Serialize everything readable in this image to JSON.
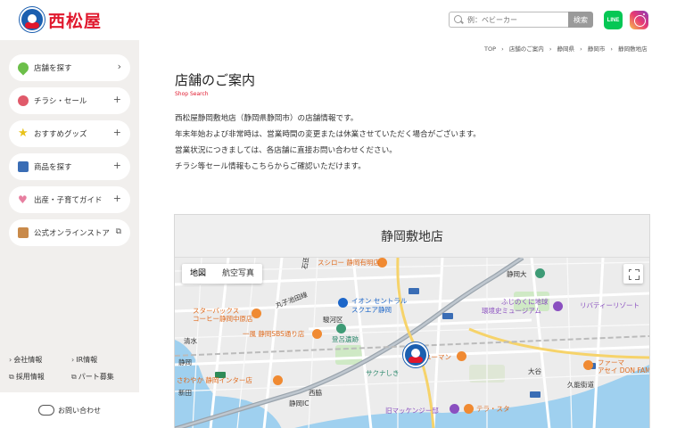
{
  "header": {
    "logo_text": "西松屋",
    "search_placeholder": "例：ベビーカー",
    "search_button": "検索",
    "line_label": "LINE"
  },
  "sidebar": {
    "items": [
      {
        "label": "店舗を探す",
        "trail": "›",
        "icon": "map-pin-icon",
        "color": "#6cbf4a"
      },
      {
        "label": "チラシ・セール",
        "trail": "+",
        "icon": "percent-icon",
        "color": "#e05a6a"
      },
      {
        "label": "おすすめグッズ",
        "trail": "+",
        "icon": "star-icon",
        "color": "#e8c21a"
      },
      {
        "label": "商品を探す",
        "trail": "+",
        "icon": "clothes-icon",
        "color": "#3a6db5"
      },
      {
        "label": "出産・子育てガイド",
        "trail": "+",
        "icon": "heart-icon",
        "color": "#e77fa0"
      },
      {
        "label": "公式オンラインストア",
        "trail": "⧉",
        "icon": "cart-icon",
        "color": "#c98a4a"
      }
    ],
    "links": [
      {
        "label": "会社情報",
        "mark": "›"
      },
      {
        "label": "IR情報",
        "mark": "›"
      },
      {
        "label": "採用情報",
        "mark": "⧉"
      },
      {
        "label": "パート募集",
        "mark": "⧉"
      }
    ],
    "contact": "お問い合わせ"
  },
  "breadcrumb": [
    "TOP",
    "›",
    "店舗のご案内",
    "›",
    "静岡県",
    "›",
    "静岡市",
    "›",
    "静岡敷地店"
  ],
  "main": {
    "title": "店舗のご案内",
    "subtitle": "Shop Search",
    "intro": [
      "西松屋静岡敷地店（静岡県静岡市）の店舗情報です。",
      "年末年始および非常時は、営業時間の変更または休業させていただく場合がございます。",
      "営業状況につきましては、各店舗に直接お問い合わせください。",
      "チラシ等セール情報もこちらからご確認いただけます。"
    ],
    "store_name": "静岡敷地店"
  },
  "map": {
    "tabs": [
      "地図",
      "航空写真"
    ],
    "labels": [
      {
        "text": "スシロー 静岡有明店",
        "color": "orange"
      },
      {
        "text": "静岡大",
        "color": "dark"
      },
      {
        "text": "イオン セントラル",
        "color": "blue"
      },
      {
        "text": "スクエア静岡",
        "color": "blue"
      },
      {
        "text": "スターバックス",
        "color": "orange"
      },
      {
        "text": "コーヒー静岡中原店",
        "color": "orange"
      },
      {
        "text": "駿河区",
        "color": "dark"
      },
      {
        "text": "一風 静岡SBS通り店",
        "color": "orange"
      },
      {
        "text": "登呂遺跡",
        "color": "teal"
      },
      {
        "text": "ふじのくに地球",
        "color": "purple"
      },
      {
        "text": "環境史ミュージアム",
        "color": "purple"
      },
      {
        "text": "リバティーリゾート",
        "color": "purple"
      },
      {
        "text": "ユーマン",
        "color": "orange"
      },
      {
        "text": "サクナしき",
        "color": "teal"
      },
      {
        "text": "大谷",
        "color": "dark"
      },
      {
        "text": "久能街道",
        "color": "dark"
      },
      {
        "text": "ファーマ",
        "color": "orange"
      },
      {
        "text": "アセイ DON FAM",
        "color": "orange"
      },
      {
        "text": "さわやか 静岡インター店",
        "color": "orange"
      },
      {
        "text": "西脇",
        "color": "dark"
      },
      {
        "text": "静岡IC",
        "color": "dark"
      },
      {
        "text": "旧マッケンジー邸",
        "color": "purple"
      },
      {
        "text": "テラ・スタ",
        "color": "orange"
      },
      {
        "text": "石田街道",
        "color": "dark"
      },
      {
        "text": "丸子池田線",
        "color": "dark"
      },
      {
        "text": "静岡",
        "color": "dark"
      },
      {
        "text": "清水",
        "color": "dark"
      },
      {
        "text": "新田",
        "color": "dark"
      }
    ]
  },
  "colors": {
    "brand_red": "#e0182d",
    "brand_blue": "#1b5fb0",
    "sidebar_bg": "#f1efed"
  }
}
